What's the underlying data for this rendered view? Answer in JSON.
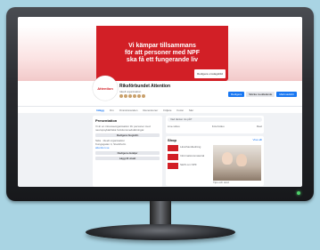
{
  "cover": {
    "line1": "Vi kämpar tillsammans",
    "line2": "för att personer med NPF",
    "line3": "ska få ett fungerande liv",
    "edit_label": "Redigera omslagsbild"
  },
  "profile": {
    "logo_text": "Attention",
    "page_name": "Riksförbundet Attention",
    "page_sub": "Ideell organisation"
  },
  "actions": {
    "primary": "Redigera",
    "secondary": "Skicka meddelande",
    "tertiary": "Marknadsför"
  },
  "tabs": [
    "Inlägg",
    "Om",
    "Omnämnanden",
    "Recensioner",
    "Följare",
    "Foton",
    "Mer"
  ],
  "left": {
    "title": "Presentation",
    "text": "Vi är en intresseorganisation för personer med neuropsykiatriska funktionsnedsättningar.",
    "button1": "Redigera biografin",
    "info1": "Sida · Ideell organisation",
    "info2": "Kungsgatan 4, Stockholm",
    "link": "attention.se",
    "button2": "Redigera detaljer",
    "button3": "Lägg till utvalt"
  },
  "composer": {
    "placeholder": "Vad tänker du på?",
    "a1": "Live-video",
    "a2": "Foto/video",
    "a3": "Reel"
  },
  "shop": {
    "title": "Shop",
    "see_all": "Visa allt",
    "items": [
      "Lärarhandledning",
      "Informationsmaterial",
      "Skrift om NPF"
    ],
    "caption": "Tips och stöd"
  }
}
